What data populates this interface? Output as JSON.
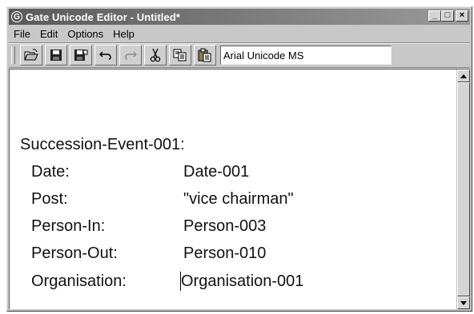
{
  "window": {
    "title": "Gate Unicode Editor - Untitled*",
    "app_icon_glyph": "G",
    "minimize_glyph": "_",
    "maximize_glyph": "□",
    "close_glyph": "×"
  },
  "menu": {
    "items": [
      {
        "label": "File"
      },
      {
        "label": "Edit"
      },
      {
        "label": "Options"
      },
      {
        "label": "Help"
      }
    ]
  },
  "toolbar": {
    "buttons": [
      {
        "icon": "open-folder-icon"
      },
      {
        "icon": "save-icon"
      },
      {
        "icon": "save-as-icon"
      },
      {
        "icon": "undo-icon"
      },
      {
        "icon": "redo-icon"
      },
      {
        "icon": "cut-icon"
      },
      {
        "icon": "copy-icon"
      },
      {
        "icon": "paste-icon"
      }
    ],
    "font_value": "Arial Unicode MS"
  },
  "document": {
    "heading": "Succession-Event-001:",
    "fields": [
      {
        "key": "Date:",
        "value": "Date-001"
      },
      {
        "key": "Post:",
        "value": "\"vice chairman\""
      },
      {
        "key": "Person-In:",
        "value": "Person-003"
      },
      {
        "key": "Person-Out:",
        "value": "Person-010"
      },
      {
        "key": "Organisation:",
        "value": "Organisation-001"
      }
    ]
  },
  "colors": {
    "titlebar_start": "#5a5a5a",
    "titlebar_end": "#9a9a9a",
    "chrome": "#c8c8c8"
  }
}
